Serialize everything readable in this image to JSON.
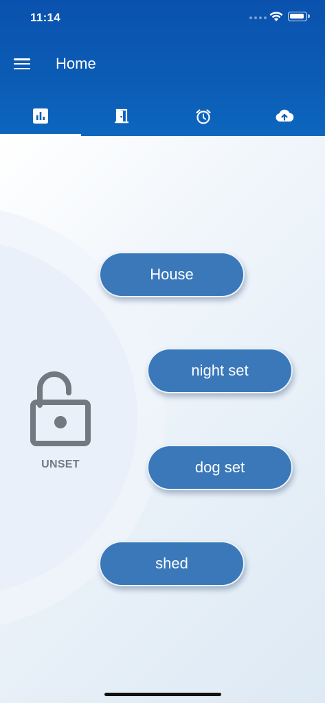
{
  "status_bar": {
    "time": "11:14"
  },
  "header": {
    "title": "Home",
    "menu_icon": "hamburger-menu-icon"
  },
  "tabs": [
    {
      "icon": "bar-chart-icon",
      "active": true
    },
    {
      "icon": "door-icon",
      "active": false
    },
    {
      "icon": "alarm-clock-icon",
      "active": false
    },
    {
      "icon": "cloud-upload-icon",
      "active": false
    }
  ],
  "system_status": {
    "icon": "unlocked-padlock-icon",
    "label": "UNSET"
  },
  "zones": [
    {
      "label": "House"
    },
    {
      "label": "night set"
    },
    {
      "label": "dog set"
    },
    {
      "label": "shed"
    }
  ],
  "colors": {
    "header": "#0b5cb5",
    "button": "#3a78ba",
    "lock": "#707a80"
  }
}
